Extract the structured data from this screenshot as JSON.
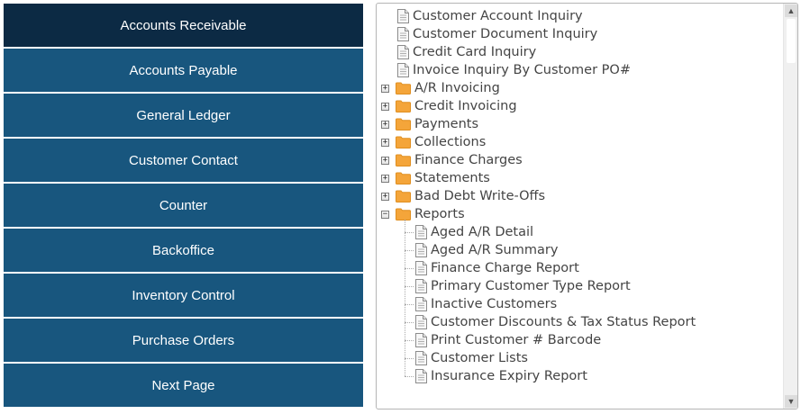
{
  "nav": {
    "items": [
      {
        "label": "Accounts Receivable",
        "active": true
      },
      {
        "label": "Accounts Payable",
        "active": false
      },
      {
        "label": "General Ledger",
        "active": false
      },
      {
        "label": "Customer Contact",
        "active": false
      },
      {
        "label": "Counter",
        "active": false
      },
      {
        "label": "Backoffice",
        "active": false
      },
      {
        "label": "Inventory Control",
        "active": false
      },
      {
        "label": "Purchase Orders",
        "active": false
      },
      {
        "label": "Next Page",
        "active": false
      }
    ]
  },
  "tree": {
    "items": [
      {
        "label": "Customer Account Inquiry",
        "type": "document",
        "level": 0
      },
      {
        "label": "Customer Document Inquiry",
        "type": "document",
        "level": 0
      },
      {
        "label": "Credit Card Inquiry",
        "type": "document",
        "level": 0
      },
      {
        "label": "Invoice Inquiry By Customer PO#",
        "type": "document",
        "level": 0
      },
      {
        "label": "A/R Invoicing",
        "type": "folder",
        "level": 0,
        "expanded": false
      },
      {
        "label": "Credit Invoicing",
        "type": "folder",
        "level": 0,
        "expanded": false
      },
      {
        "label": "Payments",
        "type": "folder",
        "level": 0,
        "expanded": false
      },
      {
        "label": "Collections",
        "type": "folder",
        "level": 0,
        "expanded": false
      },
      {
        "label": "Finance Charges",
        "type": "folder",
        "level": 0,
        "expanded": false
      },
      {
        "label": "Statements",
        "type": "folder",
        "level": 0,
        "expanded": false
      },
      {
        "label": "Bad Debt Write-Offs",
        "type": "folder",
        "level": 0,
        "expanded": false
      },
      {
        "label": "Reports",
        "type": "folder",
        "level": 0,
        "expanded": true
      },
      {
        "label": "Aged A/R Detail",
        "type": "document",
        "level": 1
      },
      {
        "label": "Aged A/R Summary",
        "type": "document",
        "level": 1
      },
      {
        "label": "Finance Charge Report",
        "type": "document",
        "level": 1
      },
      {
        "label": "Primary Customer Type Report",
        "type": "document",
        "level": 1
      },
      {
        "label": "Inactive Customers",
        "type": "document",
        "level": 1
      },
      {
        "label": "Customer Discounts & Tax Status Report",
        "type": "document",
        "level": 1
      },
      {
        "label": "Print Customer # Barcode",
        "type": "document",
        "level": 1
      },
      {
        "label": "Customer Lists",
        "type": "document",
        "level": 1
      },
      {
        "label": "Insurance Expiry Report",
        "type": "document",
        "level": 1
      }
    ]
  },
  "scrollbar": {
    "up_icon": "arrow-up-icon",
    "down_icon": "arrow-down-icon",
    "up_glyph": "▲",
    "down_glyph": "▼"
  },
  "colors": {
    "nav_bg": "#18567e",
    "nav_active_bg": "#0c2a44",
    "folder": "#f4a53a",
    "text": "#444444"
  }
}
